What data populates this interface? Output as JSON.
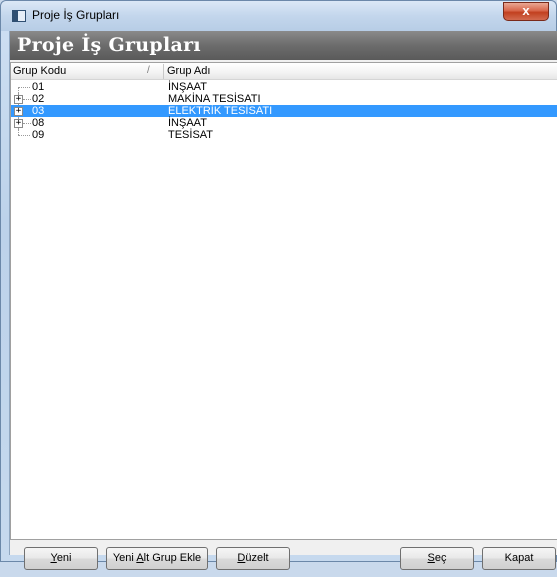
{
  "window": {
    "title": "Proje İş Grupları",
    "close_glyph": "x"
  },
  "header": {
    "title": "Proje İş Grupları"
  },
  "grid": {
    "columns": {
      "code": "Grup Kodu",
      "sort_indicator": "/",
      "name": "Grup Adı"
    },
    "rows": [
      {
        "code": "01",
        "name": "İNŞAAT",
        "has_children": false,
        "selected": false
      },
      {
        "code": "02",
        "name": "MAKİNA TESİSATI",
        "has_children": true,
        "selected": false
      },
      {
        "code": "03",
        "name": "ELEKTRİK TESİSATI",
        "has_children": true,
        "selected": true
      },
      {
        "code": "08",
        "name": "İNŞAAT",
        "has_children": true,
        "selected": false
      },
      {
        "code": "09",
        "name": "TESİSAT",
        "has_children": false,
        "selected": false
      }
    ],
    "selection_color": "#3399ff"
  },
  "buttons": {
    "new": {
      "prefix": "",
      "mnemonic": "Y",
      "suffix": "eni"
    },
    "add_sub": {
      "prefix": "Yeni ",
      "mnemonic": "A",
      "suffix": "lt Grup Ekle"
    },
    "edit": {
      "prefix": "",
      "mnemonic": "D",
      "suffix": "üzelt"
    },
    "select": {
      "prefix": "",
      "mnemonic": "S",
      "suffix": "eç"
    },
    "close": {
      "prefix": "",
      "mnemonic": "",
      "suffix": "Kapat"
    }
  }
}
